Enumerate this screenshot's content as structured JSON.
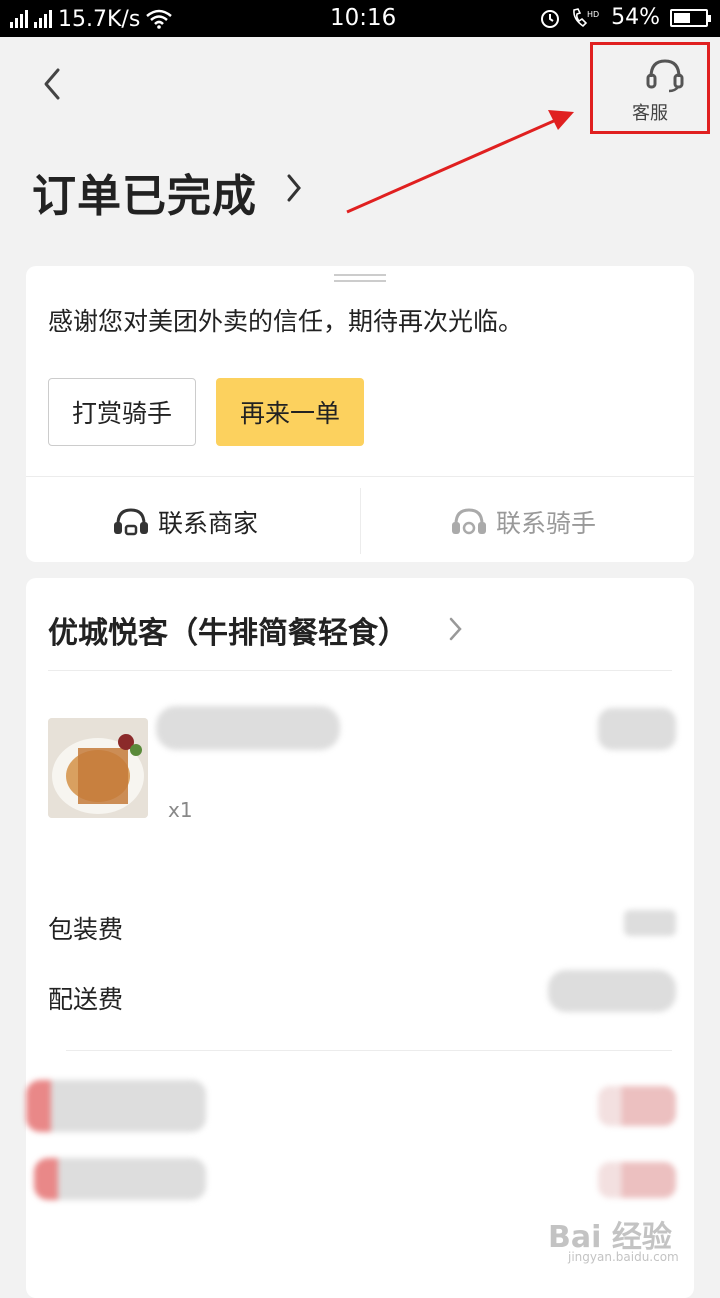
{
  "status_bar": {
    "net_left": "4G",
    "net_right": "2G",
    "speed": "15.7K/s",
    "time": "10:16",
    "hd": "HD",
    "battery_percent_text": "54%",
    "battery_level": 0.54
  },
  "header": {
    "service_label": "客服"
  },
  "order": {
    "status_title": "订单已完成"
  },
  "status_card": {
    "thanks_text": "感谢您对美团外卖的信任，期待再次光临。",
    "tip_rider_label": "打赏骑手",
    "reorder_label": "再来一单",
    "contact_merchant_label": "联系商家",
    "contact_rider_label": "联系骑手"
  },
  "shop_card": {
    "shop_name": "优城悦客（牛排简餐轻食）",
    "item_qty": "x1",
    "packing_fee_label": "包装费",
    "delivery_fee_label": "配送费"
  },
  "colors": {
    "accent_yellow": "#fcd15e",
    "annotation_red": "#e02020"
  },
  "icons": [
    "back-arrow-icon",
    "headset-icon",
    "chevron-right-icon",
    "merchant-chat-icon",
    "rider-chat-icon"
  ],
  "watermark": {
    "brand": "Bai  经验",
    "url": "jingyan.baidu.com"
  }
}
